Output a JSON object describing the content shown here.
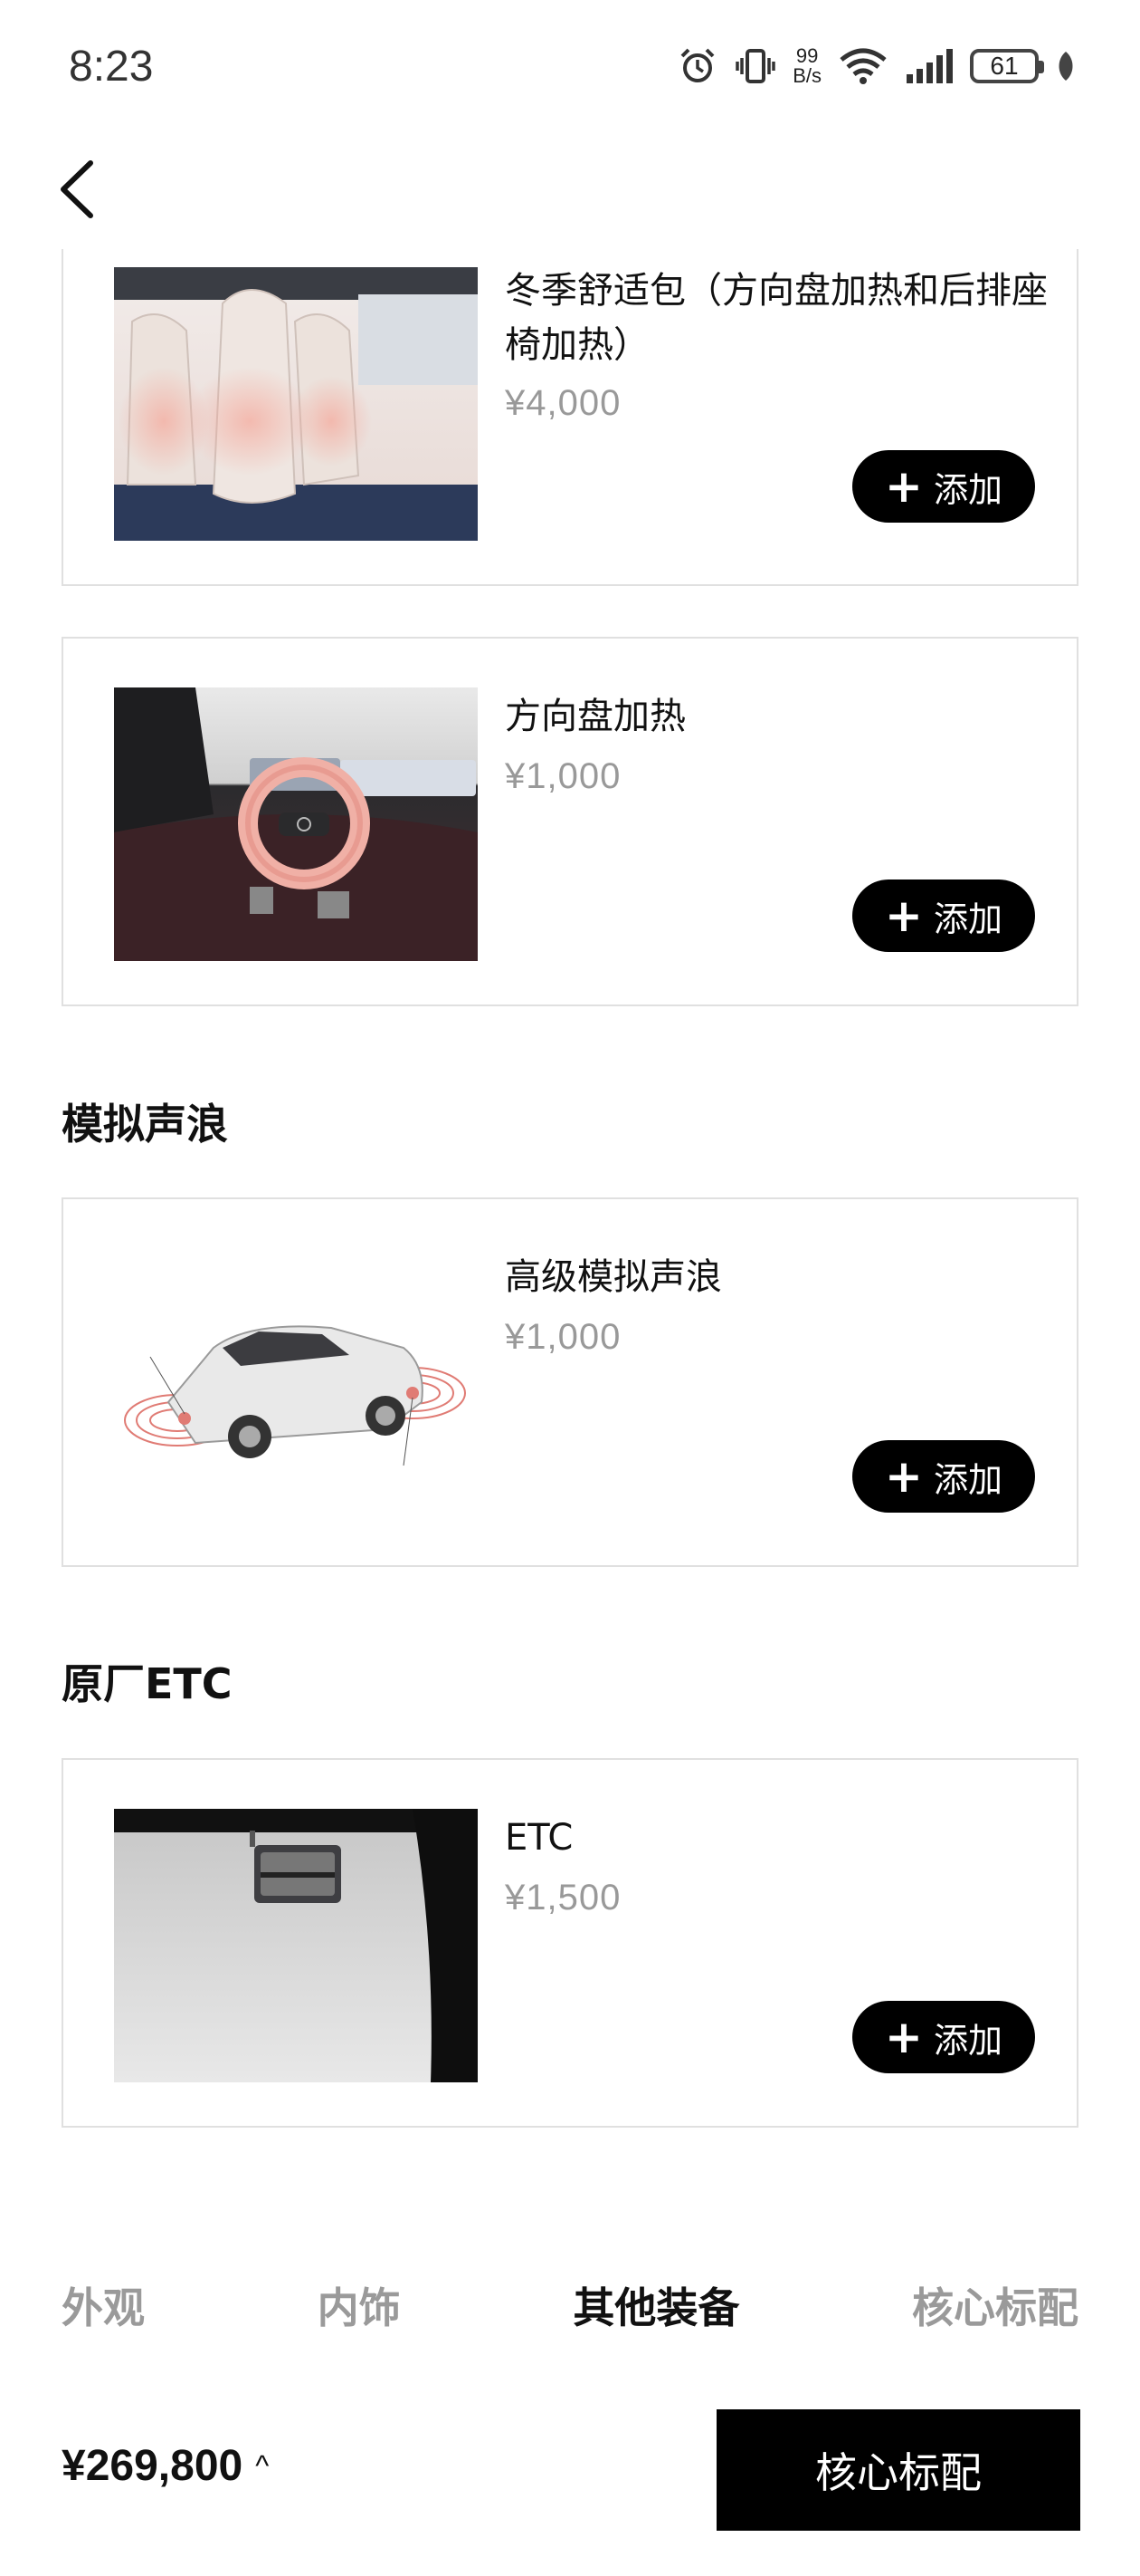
{
  "status_bar": {
    "time": "8:23",
    "net_speed_value": "99",
    "net_speed_unit": "B/s",
    "battery_level": "61",
    "icons": [
      "alarm-icon",
      "vibrate-icon",
      "wifi-icon",
      "signal-icon",
      "battery-icon",
      "leaf-icon"
    ]
  },
  "nav": {
    "back_icon": "chevron-left-icon"
  },
  "items": [
    {
      "name": "冬季舒适包（方向盘加热和后排座椅加热）",
      "price": "¥4,000",
      "add_label": "添加",
      "image": "heated-seats-image"
    },
    {
      "name": "方向盘加热",
      "price": "¥1,000",
      "add_label": "添加",
      "image": "heated-steering-wheel-image"
    },
    {
      "name": "高级模拟声浪",
      "price": "¥1,000",
      "add_label": "添加",
      "image": "sound-wave-car-image"
    },
    {
      "name": "ETC",
      "price": "¥1,500",
      "add_label": "添加",
      "image": "etc-device-image"
    }
  ],
  "sections": {
    "sound": "模拟声浪",
    "etc": "原厂ETC"
  },
  "tabs": [
    {
      "label": "外观",
      "active": false
    },
    {
      "label": "内饰",
      "active": false
    },
    {
      "label": "其他装备",
      "active": true
    },
    {
      "label": "核心标配",
      "active": false
    }
  ],
  "footer": {
    "total_price": "¥269,800",
    "primary_label": "核心标配"
  },
  "colors": {
    "accent": "#000000",
    "muted": "#999999",
    "border": "#e0e0e0"
  }
}
